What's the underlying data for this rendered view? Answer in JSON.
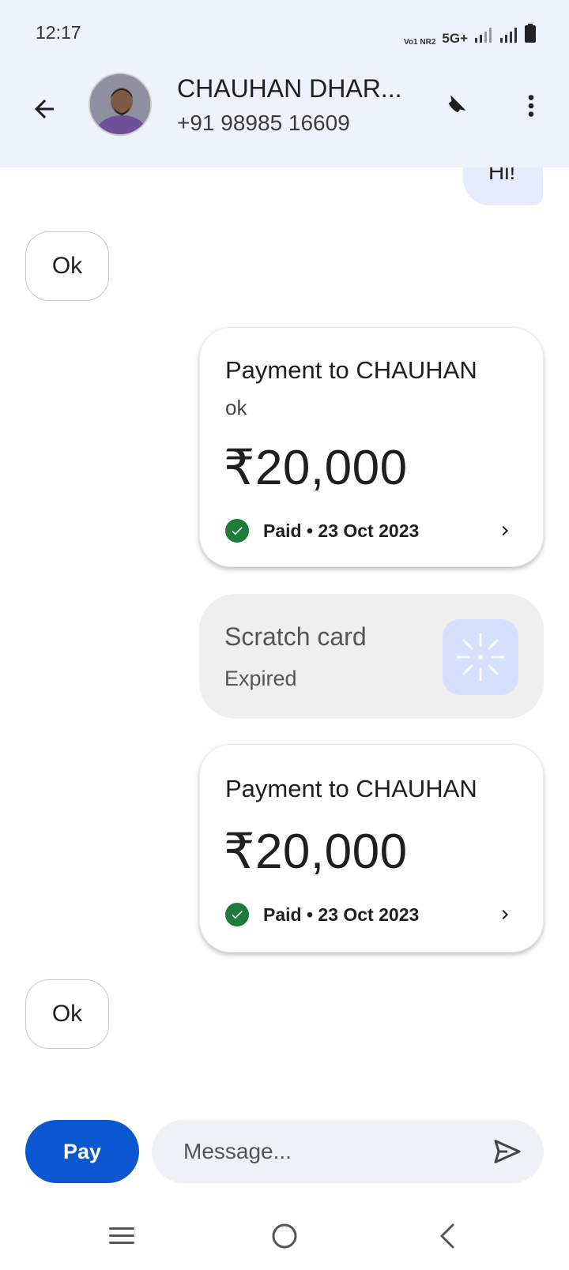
{
  "status_bar": {
    "time": "12:17",
    "volte_label": "Vo1 NR2",
    "network": "5G+",
    "icons": [
      "signal-icon",
      "signal-icon",
      "battery-icon"
    ]
  },
  "header": {
    "back_icon": "arrow-back-icon",
    "contact_name": "CHAUHAN DHAR...",
    "contact_phone": "+91 98985 16609",
    "call_icon": "phone-icon",
    "more_icon": "more-vert-icon"
  },
  "messages": {
    "partial_outgoing": "Hi!",
    "incoming_1": "Ok",
    "payment_1": {
      "title": "Payment to CHAUHAN",
      "note": "ok",
      "amount": "₹20,000",
      "status": "Paid • 23 Oct 2023"
    },
    "scratch_card": {
      "title": "Scratch card",
      "status": "Expired"
    },
    "payment_2": {
      "title": "Payment to CHAUHAN",
      "amount": "₹20,000",
      "status": "Paid • 23 Oct 2023"
    },
    "incoming_2": "Ok"
  },
  "composer": {
    "pay_label": "Pay",
    "message_placeholder": "Message...",
    "send_icon": "send-icon"
  },
  "nav": {
    "icons": [
      "menu-icon",
      "home-icon",
      "back-icon"
    ]
  },
  "colors": {
    "header_bg": "#eef2fa",
    "accent": "#0b57d0",
    "paid_green": "#1e7b3a"
  }
}
